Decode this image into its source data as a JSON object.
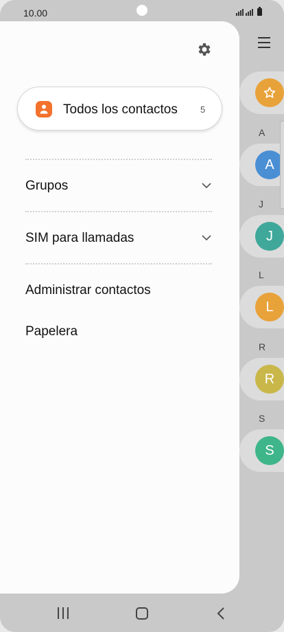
{
  "status_bar": {
    "time": "10.00"
  },
  "drawer": {
    "all_contacts": {
      "label": "Todos los contactos",
      "count": "5",
      "icon": "contacts-person-icon",
      "icon_color": "#f3722c"
    },
    "items": [
      {
        "label": "Grupos",
        "expandable": true
      },
      {
        "label": "SIM para llamadas",
        "expandable": true
      },
      {
        "label": "Administrar contactos",
        "expandable": false
      },
      {
        "label": "Papelera",
        "expandable": false
      }
    ]
  },
  "background_list": {
    "favorites_icon": "star-icon",
    "sections": [
      {
        "letter": "A",
        "avatar": "A",
        "color": "#4a8fd4"
      },
      {
        "letter": "J",
        "avatar": "J",
        "color": "#3fa89a"
      },
      {
        "letter": "L",
        "avatar": "L",
        "color": "#e8a23a"
      },
      {
        "letter": "R",
        "avatar": "R",
        "color": "#c9b74a"
      },
      {
        "letter": "S",
        "avatar": "S",
        "color": "#3fb58a"
      }
    ]
  },
  "colors": {
    "drawer_bg": "#fcfcfc",
    "scrim": "#c9c9c9",
    "favorites": "#e8a23a"
  }
}
